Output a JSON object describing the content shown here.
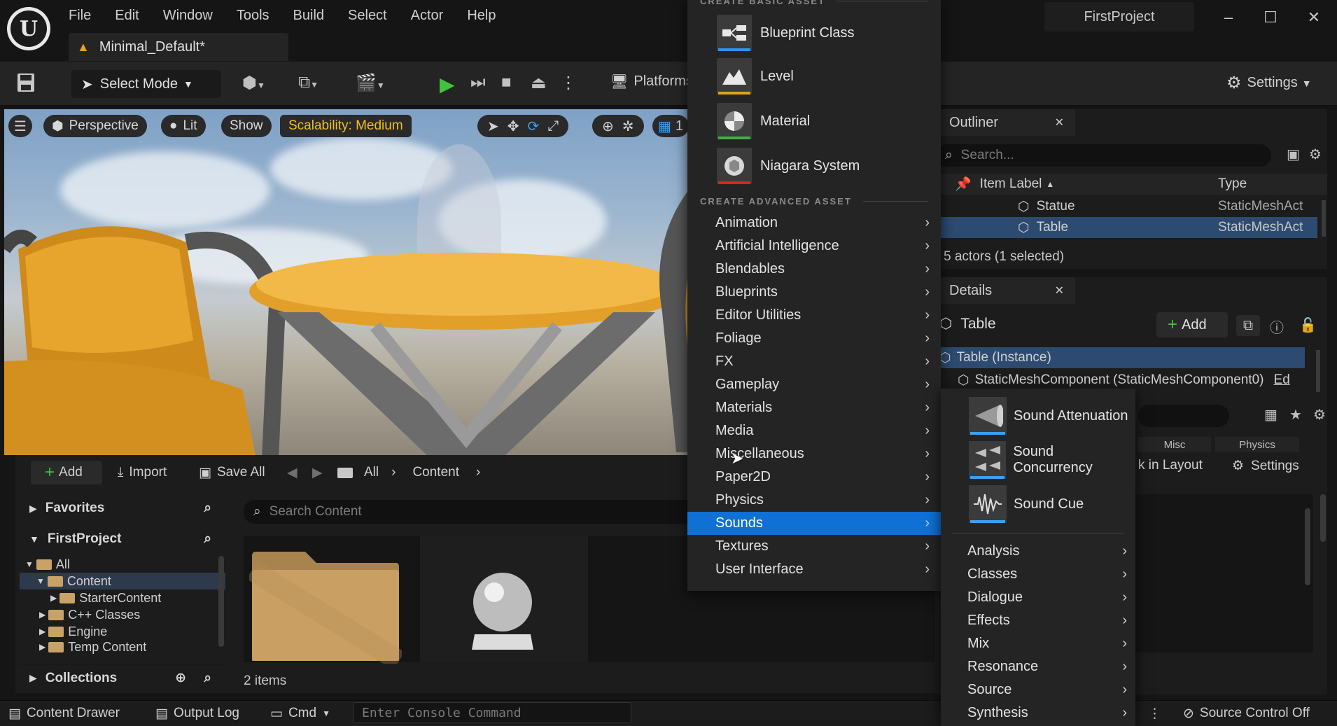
{
  "menubar": [
    "File",
    "Edit",
    "Window",
    "Tools",
    "Build",
    "Select",
    "Actor",
    "Help"
  ],
  "document_tab": "Minimal_Default*",
  "project_name": "FirstProject",
  "toolbar": {
    "select_mode": "Select Mode",
    "platforms": "Platforms",
    "settings": "Settings"
  },
  "viewport": {
    "perspective": "Perspective",
    "lit": "Lit",
    "show": "Show",
    "scalability": "Scalability: Medium",
    "grid_value": "1"
  },
  "content_browser": {
    "add": "Add",
    "import": "Import",
    "save_all": "Save All",
    "breadcrumb": [
      "All",
      "Content"
    ],
    "search_placeholder": "Search Content",
    "favorites": "Favorites",
    "project": "FirstProject",
    "collections": "Collections",
    "tree": [
      "All",
      "Content",
      "StarterContent",
      "C++ Classes",
      "Engine",
      "Temp Content"
    ],
    "item_count": "2 items"
  },
  "outliner": {
    "title": "Outliner",
    "search_placeholder": "Search...",
    "col_label": "Item Label",
    "col_type": "Type",
    "rows": [
      {
        "label": "Statue",
        "type": "StaticMeshAct"
      },
      {
        "label": "Table",
        "type": "StaticMeshAct"
      }
    ],
    "status": "5 actors (1 selected)"
  },
  "details": {
    "title": "Details",
    "actor": "Table",
    "add": "Add",
    "instance": "Table (Instance)",
    "component": "StaticMeshComponent (StaticMeshComponent0)",
    "component_suffix": "Ed",
    "tabs": [
      "Misc",
      "Physics"
    ],
    "layout_link": "k in Layout",
    "settings": "Settings"
  },
  "create_menu": {
    "section_basic": "CREATE BASIC ASSET",
    "basic": [
      {
        "label": "Blueprint Class",
        "color": "#3a8ef0"
      },
      {
        "label": "Level",
        "color": "#e0a020"
      },
      {
        "label": "Material",
        "color": "#40b040"
      },
      {
        "label": "Niagara System",
        "color": "#e02020"
      }
    ],
    "section_advanced": "CREATE ADVANCED ASSET",
    "advanced": [
      "Animation",
      "Artificial Intelligence",
      "Blendables",
      "Blueprints",
      "Editor Utilities",
      "Foliage",
      "FX",
      "Gameplay",
      "Materials",
      "Media",
      "Miscellaneous",
      "Paper2D",
      "Physics",
      "Sounds",
      "Textures",
      "User Interface"
    ],
    "active": "Sounds"
  },
  "sounds_submenu": {
    "assets": [
      "Sound Attenuation",
      "Sound Concurrency",
      "Sound Cue"
    ],
    "categories": [
      "Analysis",
      "Classes",
      "Dialogue",
      "Effects",
      "Mix",
      "Resonance",
      "Source",
      "Synthesis"
    ]
  },
  "bottombar": {
    "content_drawer": "Content Drawer",
    "output_log": "Output Log",
    "cmd": "Cmd",
    "console_placeholder": "Enter Console Command",
    "source_control": "Source Control Off"
  }
}
